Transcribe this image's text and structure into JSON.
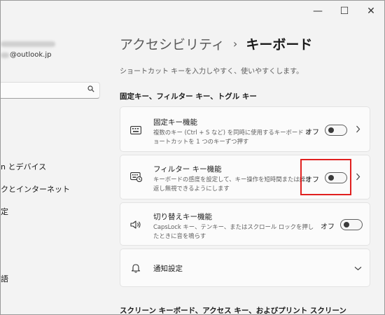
{
  "window": {
    "minimize": "—",
    "maximize": "☐",
    "close": "✕"
  },
  "account": {
    "email": "@outlook.jp"
  },
  "sidebar": {
    "search_icon": "search-icon",
    "items": [
      {
        "label": "n とデバイス"
      },
      {
        "label": "クとインターネット"
      },
      {
        "label": "定"
      },
      {
        "label": "語"
      }
    ]
  },
  "header": {
    "parent": "アクセシビリティ",
    "separator": "›",
    "current": "キーボード",
    "subtitle": "ショートカット キーを入力しやすく、使いやすくします。"
  },
  "section1": {
    "title": "固定キー、フィルター キー、トグル キー"
  },
  "cards": [
    {
      "icon": "keyboard-icon",
      "title": "固定キー機能",
      "desc": "複数のキー (Ctrl + S など) を同時に使用するキーボード ショートカットを 1 つのキーずつ押す",
      "state": "オフ",
      "on": false
    },
    {
      "icon": "keyboard-clock-icon",
      "title": "フィルター キー機能",
      "desc": "キーボードの感度を設定して、キー操作を短時間または繰り返し無視できるようにします",
      "state": "オフ",
      "on": false
    },
    {
      "icon": "speaker-icon",
      "title": "切り替えキー機能",
      "desc": "CapsLock キー、テンキー、またはスクロール ロックを押したときに音を鳴らす",
      "state": "オフ",
      "on": false
    },
    {
      "icon": "bell-icon",
      "title": "通知設定"
    }
  ],
  "section2": {
    "title": "スクリーン キーボード、アクセス キー、およびプリント スクリーン"
  },
  "colors": {
    "highlight": "#e0201f",
    "background": "#f3f3f3",
    "card": "#fbfbfb"
  }
}
